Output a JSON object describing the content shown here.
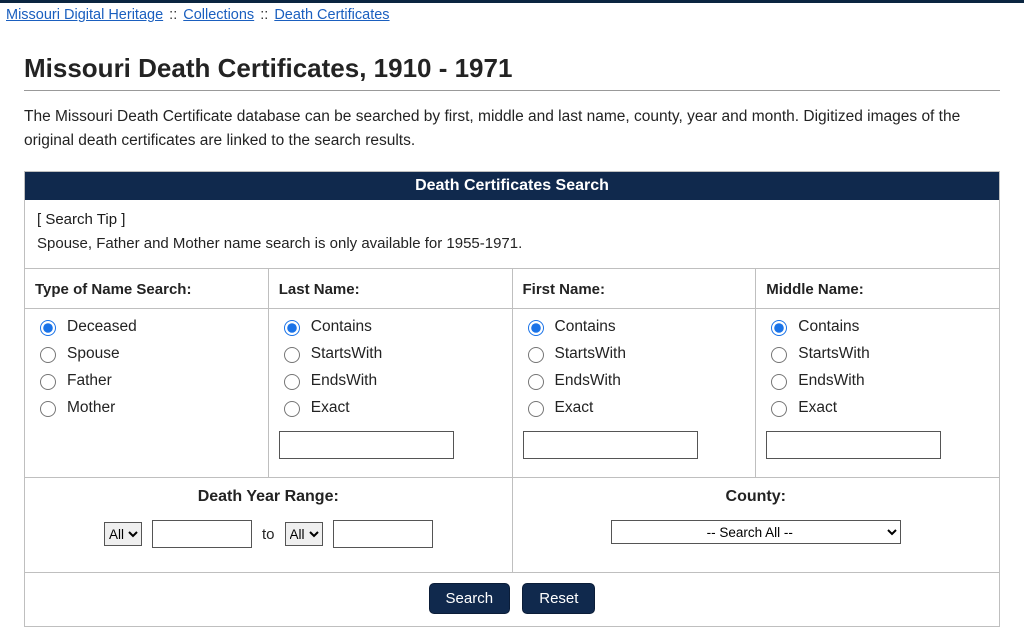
{
  "breadcrumb": {
    "link1": "Missouri Digital Heritage",
    "link2": "Collections",
    "link3": "Death Certificates",
    "sep": "::"
  },
  "page": {
    "title": "Missouri Death Certificates, 1910 - 1971",
    "intro": "The Missouri Death Certificate database can be searched by first, middle and last name, county, year and month. Digitized images of the original death certificates are linked to the search results."
  },
  "panel": {
    "header": "Death Certificates Search",
    "tip_label": "[ Search Tip ]",
    "tip_text": "Spouse, Father and Mother name search is only available for 1955-1971."
  },
  "name_type": {
    "heading": "Type of Name Search:",
    "options": [
      "Deceased",
      "Spouse",
      "Father",
      "Mother"
    ],
    "selected": 0
  },
  "match_options": [
    "Contains",
    "StartsWith",
    "EndsWith",
    "Exact"
  ],
  "last_name": {
    "heading": "Last Name:",
    "selected": 0,
    "value": ""
  },
  "first_name": {
    "heading": "First Name:",
    "selected": 0,
    "value": ""
  },
  "middle_name": {
    "heading": "Middle Name:",
    "selected": 0,
    "value": ""
  },
  "year_range": {
    "heading": "Death Year Range:",
    "from_select": "All",
    "to_select": "All",
    "to_label": "to"
  },
  "county": {
    "heading": "County:",
    "selected": "-- Search All --"
  },
  "buttons": {
    "search": "Search",
    "reset": "Reset"
  }
}
